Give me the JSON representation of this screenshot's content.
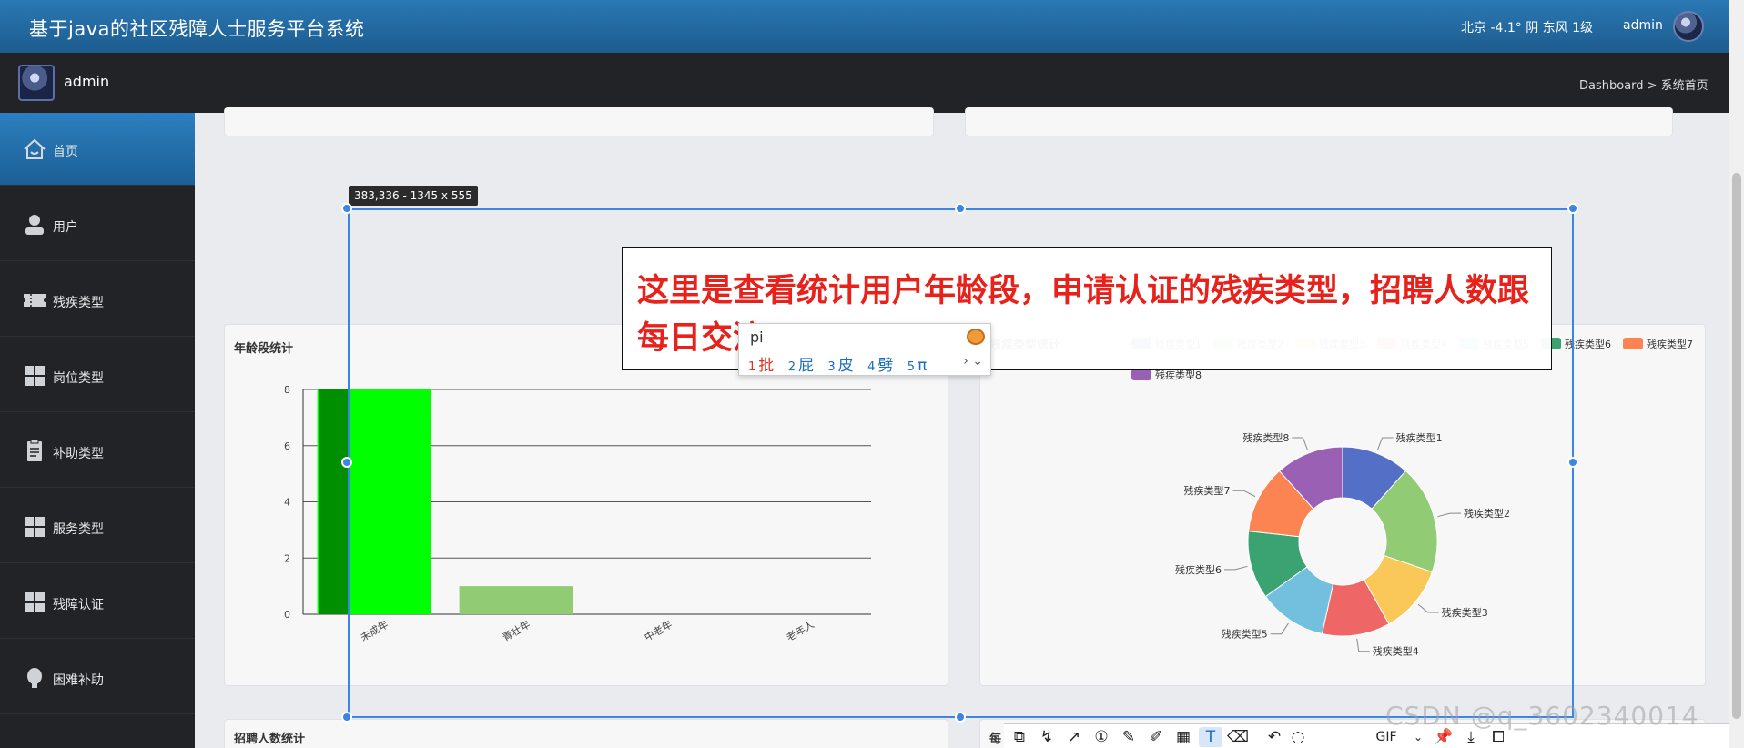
{
  "header": {
    "title": "基于java的社区残障人士服务平台系统",
    "weather": "北京  -4.1°  阴  东风  1级",
    "user": "admin"
  },
  "subbar": {
    "username": "admin",
    "breadcrumb": "Dashboard > 系统首页"
  },
  "sidebar": {
    "items": [
      {
        "label": "首页",
        "icon": "home-icon"
      },
      {
        "label": "用户",
        "icon": "user-icon"
      },
      {
        "label": "残疾类型",
        "icon": "ticket-icon"
      },
      {
        "label": "岗位类型",
        "icon": "grid-icon"
      },
      {
        "label": "补助类型",
        "icon": "document-icon"
      },
      {
        "label": "服务类型",
        "icon": "grid-icon"
      },
      {
        "label": "残障认证",
        "icon": "grid-icon"
      },
      {
        "label": "困难补助",
        "icon": "bulb-icon"
      }
    ]
  },
  "cards": {
    "age_title": "年龄段统计",
    "disability_title": "残疾类型统计",
    "recruit_title": "招聘人数统计",
    "bottom_right_title": "每"
  },
  "chart_data": [
    {
      "type": "bar",
      "title": "年龄段统计",
      "categories": [
        "未成年",
        "青壮年",
        "中老年",
        "老年人"
      ],
      "values": [
        8,
        1,
        0,
        0
      ],
      "ylim": [
        0,
        8
      ],
      "yticks": [
        0,
        2,
        4,
        6,
        8
      ],
      "colors": {
        "未成年": "#00ff00",
        "青壮年": "#91cc75"
      },
      "grid": true
    },
    {
      "type": "pie",
      "title": "残疾类型统计",
      "donut": true,
      "legend": "top-right",
      "labels": [
        "残疾类型1",
        "残疾类型2",
        "残疾类型3",
        "残疾类型4",
        "残疾类型5",
        "残疾类型6",
        "残疾类型7",
        "残疾类型8"
      ],
      "values": [
        1,
        1.6,
        1,
        1,
        1,
        1,
        1,
        1
      ],
      "colors": [
        "#5470c6",
        "#91cc75",
        "#fac858",
        "#ee6666",
        "#73c0de",
        "#3ba272",
        "#fc8452",
        "#9a60b4"
      ]
    }
  ],
  "overlay": {
    "size_tag": "383,336 - 1345 x 555",
    "annotation": "这里是查看统计用户年龄段，申请认证的残疾类型，招聘人数跟每日交流"
  },
  "ime": {
    "input": "pi",
    "candidates": [
      {
        "num": "1",
        "char": "批"
      },
      {
        "num": "2",
        "char": "屁"
      },
      {
        "num": "3",
        "char": "皮"
      },
      {
        "num": "4",
        "char": "劈"
      },
      {
        "num": "5",
        "char": "π"
      }
    ],
    "more": "› ⌄"
  },
  "toolbar": {
    "gif_label": "GIF"
  },
  "watermark": "CSDN @q_3602340014"
}
